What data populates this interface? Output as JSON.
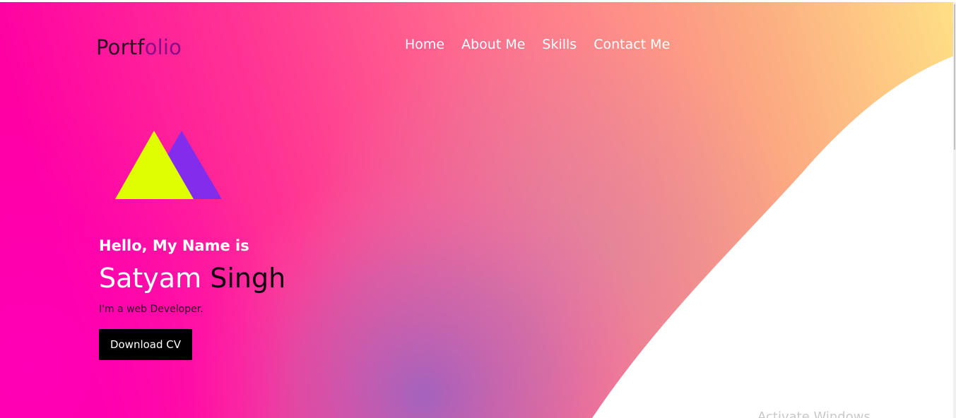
{
  "header": {
    "logo_part1": "Portf",
    "logo_part2": "olio",
    "nav": [
      {
        "label": "Home"
      },
      {
        "label": "About Me"
      },
      {
        "label": "Skills"
      },
      {
        "label": "Contact Me"
      }
    ]
  },
  "hero": {
    "greeting": "Hello, My Name is",
    "first_name": "Satyam",
    "last_name": "Singh",
    "subtitle": "I'm a web Developer.",
    "download_label": "Download CV"
  },
  "watermark": {
    "text": "Activate Windows"
  },
  "colors": {
    "gradient_pink": "#ff00a8",
    "gradient_coral": "#ff7290",
    "gradient_purple": "#9b5fc4",
    "gradient_peach": "#ffae7e",
    "gradient_yellow": "#ffe184",
    "triangle_yellow": "#dfff00",
    "triangle_purple": "#842cec",
    "button_bg": "#000000"
  }
}
